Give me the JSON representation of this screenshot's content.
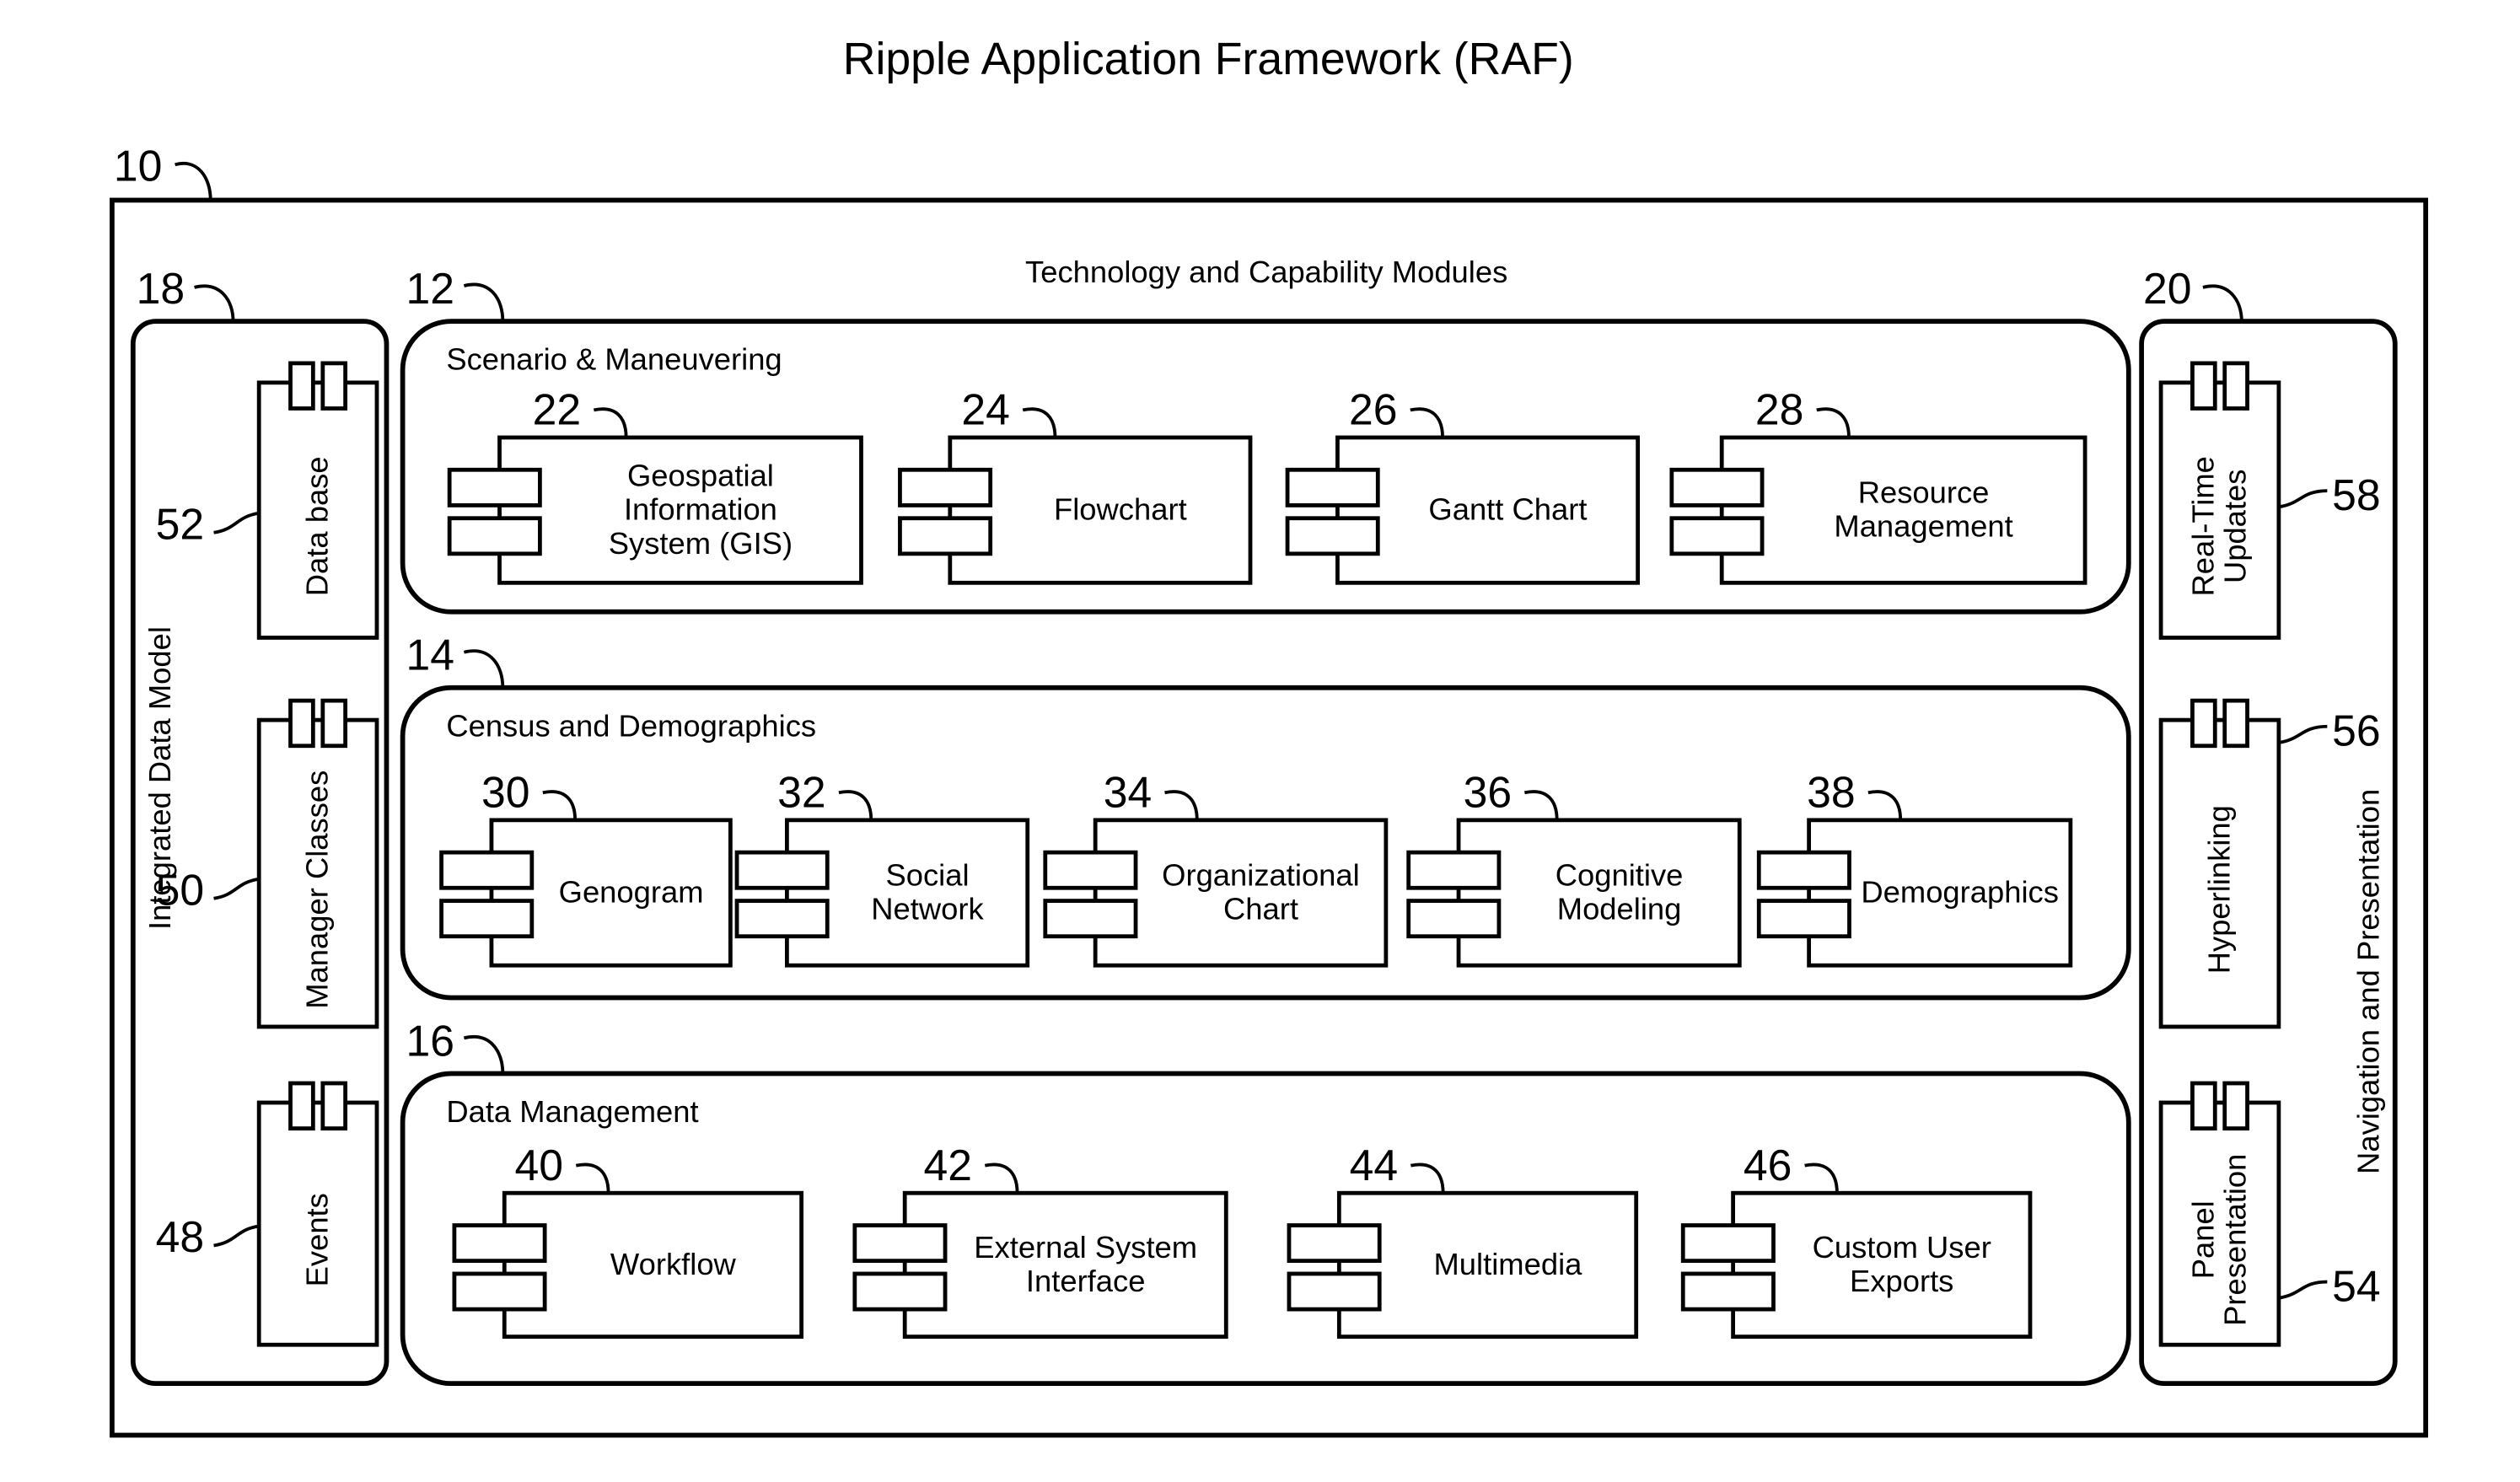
{
  "title": "Ripple Application Framework (RAF)",
  "framework": {
    "ref": "10",
    "heading": "Technology and Capability Modules",
    "left_panel": {
      "ref": "18",
      "label": "Integrated Data Model",
      "components": [
        {
          "ref": "52",
          "label": "Data base"
        },
        {
          "ref": "50",
          "label": "Manager Classes"
        },
        {
          "ref": "48",
          "label": "Events"
        }
      ]
    },
    "right_panel": {
      "ref": "20",
      "label": "Navigation and Presentation",
      "components": [
        {
          "ref": "58",
          "label_lines": [
            "Real-Time",
            "Updates"
          ]
        },
        {
          "ref": "56",
          "label_lines": [
            "Hyperlinking"
          ]
        },
        {
          "ref": "54",
          "label_lines": [
            "Panel",
            "Presentation"
          ]
        }
      ]
    },
    "groups": [
      {
        "ref": "12",
        "label": "Scenario & Maneuvering",
        "components": [
          {
            "ref": "22",
            "label_lines": [
              "Geospatial",
              "Information",
              "System (GIS)"
            ]
          },
          {
            "ref": "24",
            "label_lines": [
              "Flowchart"
            ]
          },
          {
            "ref": "26",
            "label_lines": [
              "Gantt Chart"
            ]
          },
          {
            "ref": "28",
            "label_lines": [
              "Resource",
              "Management"
            ]
          }
        ]
      },
      {
        "ref": "14",
        "label": "Census and Demographics",
        "components": [
          {
            "ref": "30",
            "label_lines": [
              "Genogram"
            ]
          },
          {
            "ref": "32",
            "label_lines": [
              "Social",
              "Network"
            ]
          },
          {
            "ref": "34",
            "label_lines": [
              "Organizational",
              "Chart"
            ]
          },
          {
            "ref": "36",
            "label_lines": [
              "Cognitive",
              "Modeling"
            ]
          },
          {
            "ref": "38",
            "label_lines": [
              "Demographics"
            ]
          }
        ]
      },
      {
        "ref": "16",
        "label": "Data Management",
        "components": [
          {
            "ref": "40",
            "label_lines": [
              "Workflow"
            ]
          },
          {
            "ref": "42",
            "label_lines": [
              "External System",
              "Interface"
            ]
          },
          {
            "ref": "44",
            "label_lines": [
              "Multimedia"
            ]
          },
          {
            "ref": "46",
            "label_lines": [
              "Custom User",
              "Exports"
            ]
          }
        ]
      }
    ]
  }
}
